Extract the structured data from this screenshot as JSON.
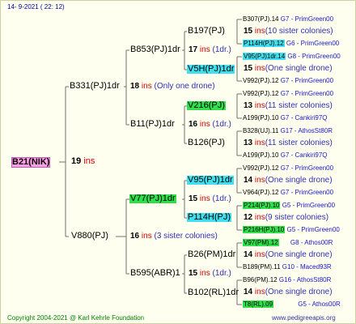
{
  "header": "14-  9-2021  ( 22: 12)",
  "root": {
    "label": "B21(NIK)",
    "ins_num": "19",
    "ins_word": "ins"
  },
  "gen1": [
    {
      "label": "B331(PJ)1dr",
      "ins_num": "18",
      "ins_word": "ins",
      "note": "(Only one drone)"
    },
    {
      "label": "V880(PJ)",
      "ins_num": "16",
      "ins_word": "ins",
      "note": "(3 sister colonies)"
    }
  ],
  "gen2": [
    {
      "label": "B853(PJ)1dr",
      "ins_num": "17",
      "ins_word": "ins",
      "note": "(1dr.)"
    },
    {
      "label": "B11(PJ)1dr",
      "ins_num": "16",
      "ins_word": "ins",
      "note": "(1dr.)"
    },
    {
      "label": "V77(PJ)1dr",
      "ins_num": "15",
      "ins_word": "ins",
      "note": "(1dr.)"
    },
    {
      "label": "B595(ABR)1",
      "ins_num": "15",
      "ins_word": "ins",
      "note": "(1dr.)"
    }
  ],
  "gen3": [
    {
      "label": "B197(PJ)",
      "ins_num": "15",
      "ins_word": "ins",
      "note": "(10 sister colonies)"
    },
    {
      "label": "V5H(PJ)1dr",
      "ins_num": "15",
      "ins_word": "ins",
      "note": "(One single drone)"
    },
    {
      "label": "V216(PJ)",
      "ins_num": "13",
      "ins_word": "ins",
      "note": "(11 sister colonies)"
    },
    {
      "label": "B126(PJ)",
      "ins_num": "13",
      "ins_word": "ins",
      "note": "(11 sister colonies)"
    },
    {
      "label": "V95(PJ)1dr",
      "ins_num": "14",
      "ins_word": "ins",
      "note": "(One single drone)"
    },
    {
      "label": "P114H(PJ)",
      "ins_num": "12",
      "ins_word": "ins",
      "note": "(9 sister colonies)"
    },
    {
      "label": "B26(PM)1dr",
      "ins_num": "14",
      "ins_word": "ins",
      "note": "(One single drone)"
    },
    {
      "label": "B102(RL)1dr",
      "ins_num": "14",
      "ins_word": "ins",
      "note": "(One single drone)"
    }
  ],
  "gen4": [
    {
      "name": "B307(PJ).14",
      "ref": "G7 - PrimGreen00"
    },
    {
      "name": "P114H(PJ).12",
      "ref": "G6 - PrimGreen00"
    },
    {
      "name": "V95(PJ)1dr.14",
      "ref": "G8 - PrimGreen00"
    },
    {
      "name": "V992(PJ).12",
      "ref": "G7 - PrimGreen00"
    },
    {
      "name": "V992(PJ).12",
      "ref": "G7 - PrimGreen00"
    },
    {
      "name": "A199(PJ).10",
      "ref": "G7 - Cankiri97Q"
    },
    {
      "name": "B328(UJ).11",
      "ref": "G17 - AthosSt80R"
    },
    {
      "name": "A199(PJ).10",
      "ref": "G7 - Cankiri97Q"
    },
    {
      "name": "V992(PJ).12",
      "ref": "G7 - PrimGreen00"
    },
    {
      "name": "V964(PJ).12",
      "ref": "G7 - PrimGreen00"
    },
    {
      "name": "P214(PJ).10",
      "ref": "G5 - PrimGreen00"
    },
    {
      "name": "P216H(PJ).10",
      "ref": "G5 - PrimGreen00"
    },
    {
      "name": "V97(PM).12",
      "ref": "G8 - Athos00R"
    },
    {
      "name": "B189(PM).11",
      "ref": "G10 - Maced93R"
    },
    {
      "name": "B96(PM).12",
      "ref": "G16 - AthosSt80R"
    },
    {
      "name": "T8(RL).09",
      "ref": "G5 - Athos00R"
    }
  ],
  "footer": {
    "left": "Copyright 2004-2021 @ Karl Kehrle Foundation",
    "right": "www.pedigreeapis.org"
  }
}
